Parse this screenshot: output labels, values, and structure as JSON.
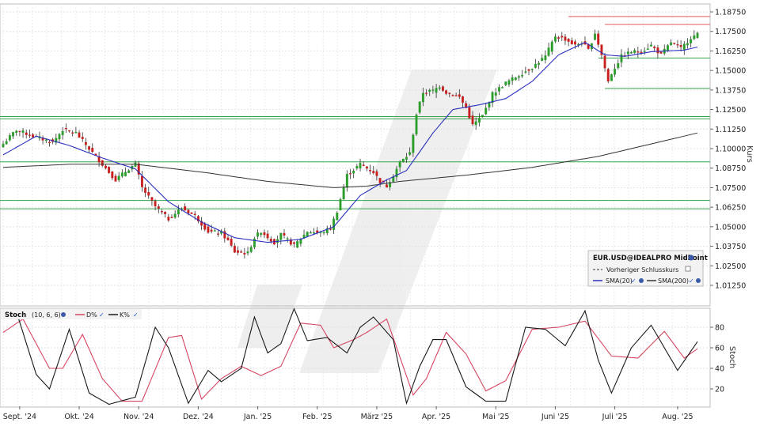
{
  "chart_data": [
    {
      "type": "candlestick",
      "instrument": "EUR.USD@IDEALPRO MidPoint",
      "ylabel": "Kurs",
      "ylim": [
        1.005,
        1.1905
      ],
      "y_ticks": [
        "1.18750",
        "1.17500",
        "1.16250",
        "1.15000",
        "1.13750",
        "1.12500",
        "1.11250",
        "1.10000",
        "1.08750",
        "1.07500",
        "1.06250",
        "1.05000",
        "1.03750",
        "1.02500",
        "1.01250"
      ],
      "x_ticks": [
        "Sept. '24",
        "Okt. '24",
        "Nov. '24",
        "Dez. '24",
        "Jan. '25",
        "Feb. '25",
        "März '25",
        "Apr. '25",
        "Mai '25",
        "Juni '25",
        "Juli '25",
        "Aug. '25"
      ],
      "grid": true,
      "legend_position": "bottom-right",
      "legend": {
        "title": "EUR.USD@IDEALPRO MidPoint",
        "prev_close": "Vorheriger Schlusskurs",
        "sma20": "SMA(20)",
        "sma200": "SMA(200)"
      },
      "colors": {
        "up": "#2a9d2a",
        "down": "#c81e1e",
        "sma20": "#2b2fbf",
        "sma200": "#333333",
        "support": "#3aa34a",
        "resistance": "#e05a5a"
      },
      "close_anchors": [
        [
          0,
          1.103
        ],
        [
          4,
          1.112
        ],
        [
          9,
          1.108
        ],
        [
          15,
          1.104
        ],
        [
          18,
          1.112
        ],
        [
          22,
          1.11
        ],
        [
          26,
          1.1
        ],
        [
          30,
          1.09
        ],
        [
          34,
          1.08
        ],
        [
          38,
          1.087
        ],
        [
          40,
          1.09
        ],
        [
          42,
          1.075
        ],
        [
          46,
          1.063
        ],
        [
          50,
          1.055
        ],
        [
          54,
          1.062
        ],
        [
          58,
          1.057
        ],
        [
          62,
          1.047
        ],
        [
          66,
          1.046
        ],
        [
          68,
          1.041
        ],
        [
          70,
          1.034
        ],
        [
          74,
          1.033
        ],
        [
          76,
          1.043
        ],
        [
          78,
          1.047
        ],
        [
          82,
          1.04
        ],
        [
          84,
          1.045
        ],
        [
          88,
          1.038
        ],
        [
          92,
          1.047
        ],
        [
          96,
          1.046
        ],
        [
          99,
          1.049
        ],
        [
          101,
          1.06
        ],
        [
          104,
          1.083
        ],
        [
          108,
          1.09
        ],
        [
          112,
          1.085
        ],
        [
          114,
          1.079
        ],
        [
          116,
          1.076
        ],
        [
          118,
          1.083
        ],
        [
          120,
          1.091
        ],
        [
          123,
          1.097
        ],
        [
          125,
          1.122
        ],
        [
          127,
          1.136
        ],
        [
          130,
          1.137
        ],
        [
          132,
          1.14
        ],
        [
          134,
          1.136
        ],
        [
          138,
          1.133
        ],
        [
          140,
          1.126
        ],
        [
          142,
          1.115
        ],
        [
          145,
          1.121
        ],
        [
          148,
          1.135
        ],
        [
          152,
          1.142
        ],
        [
          156,
          1.147
        ],
        [
          160,
          1.152
        ],
        [
          164,
          1.159
        ],
        [
          167,
          1.172
        ],
        [
          170,
          1.17
        ],
        [
          173,
          1.166
        ],
        [
          175,
          1.168
        ],
        [
          177,
          1.163
        ],
        [
          179,
          1.174
        ],
        [
          181,
          1.16
        ],
        [
          183,
          1.143
        ],
        [
          184,
          1.148
        ],
        [
          187,
          1.159
        ],
        [
          190,
          1.162
        ],
        [
          193,
          1.162
        ],
        [
          196,
          1.166
        ],
        [
          199,
          1.16
        ],
        [
          202,
          1.168
        ],
        [
          205,
          1.164
        ],
        [
          208,
          1.171
        ],
        [
          210,
          1.173
        ]
      ],
      "sma20_anchors": [
        [
          0,
          1.096
        ],
        [
          10,
          1.108
        ],
        [
          20,
          1.102
        ],
        [
          30,
          1.094
        ],
        [
          40,
          1.087
        ],
        [
          50,
          1.066
        ],
        [
          60,
          1.053
        ],
        [
          70,
          1.043
        ],
        [
          80,
          1.04
        ],
        [
          90,
          1.042
        ],
        [
          100,
          1.05
        ],
        [
          108,
          1.07
        ],
        [
          116,
          1.08
        ],
        [
          122,
          1.086
        ],
        [
          130,
          1.11
        ],
        [
          136,
          1.125
        ],
        [
          144,
          1.128
        ],
        [
          152,
          1.132
        ],
        [
          160,
          1.143
        ],
        [
          168,
          1.16
        ],
        [
          176,
          1.168
        ],
        [
          182,
          1.16
        ],
        [
          188,
          1.159
        ],
        [
          196,
          1.162
        ],
        [
          206,
          1.163
        ],
        [
          210,
          1.165
        ]
      ],
      "sma200_anchors": [
        [
          0,
          1.088
        ],
        [
          20,
          1.09
        ],
        [
          40,
          1.09
        ],
        [
          60,
          1.085
        ],
        [
          80,
          1.079
        ],
        [
          100,
          1.075
        ],
        [
          110,
          1.076
        ],
        [
          120,
          1.079
        ],
        [
          140,
          1.083
        ],
        [
          160,
          1.088
        ],
        [
          180,
          1.095
        ],
        [
          200,
          1.105
        ],
        [
          210,
          1.11
        ]
      ],
      "horizontal_lines": [
        {
          "kind": "resistance",
          "value": 1.1845,
          "from_bar": 171,
          "to_bar": 210
        },
        {
          "kind": "resistance",
          "value": 1.1795,
          "from_bar": 182,
          "to_bar": 210
        },
        {
          "kind": "support",
          "value": 1.158,
          "from_bar": 180,
          "to_bar": 210
        },
        {
          "kind": "support",
          "value": 1.1385,
          "from_bar": 182,
          "to_bar": 210
        },
        {
          "kind": "support",
          "value": 1.1205,
          "from_bar": 0,
          "to_bar": 210
        },
        {
          "kind": "support",
          "value": 1.119,
          "from_bar": 0,
          "to_bar": 210
        },
        {
          "kind": "support",
          "value": 1.0915,
          "from_bar": 0,
          "to_bar": 210
        },
        {
          "kind": "support",
          "value": 1.0668,
          "from_bar": 0,
          "to_bar": 210
        },
        {
          "kind": "support",
          "value": 1.0615,
          "from_bar": 0,
          "to_bar": 210
        }
      ]
    },
    {
      "type": "line",
      "title": "Stoch",
      "params": "(10, 6, 6)",
      "ylabel": "Stoch",
      "ylim": [
        0,
        100
      ],
      "y_ticks": [
        80,
        60,
        40,
        20
      ],
      "series": [
        {
          "name": "D%",
          "color": "#d64561",
          "anchors": [
            [
              0,
              75
            ],
            [
              6,
              88
            ],
            [
              14,
              40
            ],
            [
              18,
              40
            ],
            [
              24,
              73
            ],
            [
              30,
              30
            ],
            [
              36,
              8
            ],
            [
              42,
              8
            ],
            [
              50,
              70
            ],
            [
              54,
              72
            ],
            [
              60,
              10
            ],
            [
              66,
              30
            ],
            [
              72,
              42
            ],
            [
              78,
              33
            ],
            [
              84,
              42
            ],
            [
              90,
              84
            ],
            [
              96,
              82
            ],
            [
              100,
              60
            ],
            [
              106,
              68
            ],
            [
              110,
              75
            ],
            [
              116,
              88
            ],
            [
              124,
              14
            ],
            [
              128,
              30
            ],
            [
              134,
              75
            ],
            [
              140,
              54
            ],
            [
              146,
              18
            ],
            [
              152,
              28
            ],
            [
              160,
              78
            ],
            [
              168,
              80
            ],
            [
              176,
              86
            ],
            [
              184,
              52
            ],
            [
              192,
              50
            ],
            [
              200,
              76
            ],
            [
              206,
              50
            ],
            [
              210,
              59
            ]
          ]
        },
        {
          "name": "K%",
          "color": "#1a1a1a",
          "anchors": [
            [
              0,
              88
            ],
            [
              4,
              95
            ],
            [
              10,
              34
            ],
            [
              14,
              20
            ],
            [
              20,
              78
            ],
            [
              26,
              16
            ],
            [
              32,
              5
            ],
            [
              40,
              12
            ],
            [
              46,
              80
            ],
            [
              50,
              60
            ],
            [
              56,
              6
            ],
            [
              62,
              38
            ],
            [
              66,
              27
            ],
            [
              72,
              40
            ],
            [
              76,
              90
            ],
            [
              80,
              55
            ],
            [
              84,
              64
            ],
            [
              88,
              98
            ],
            [
              92,
              67
            ],
            [
              98,
              70
            ],
            [
              104,
              55
            ],
            [
              108,
              80
            ],
            [
              112,
              90
            ],
            [
              118,
              68
            ],
            [
              122,
              6
            ],
            [
              126,
              42
            ],
            [
              130,
              68
            ],
            [
              134,
              68
            ],
            [
              140,
              22
            ],
            [
              146,
              8
            ],
            [
              152,
              8
            ],
            [
              158,
              80
            ],
            [
              164,
              78
            ],
            [
              170,
              62
            ],
            [
              176,
              96
            ],
            [
              180,
              48
            ],
            [
              184,
              16
            ],
            [
              190,
              60
            ],
            [
              196,
              82
            ],
            [
              200,
              60
            ],
            [
              204,
              38
            ],
            [
              210,
              66
            ]
          ]
        }
      ]
    }
  ]
}
